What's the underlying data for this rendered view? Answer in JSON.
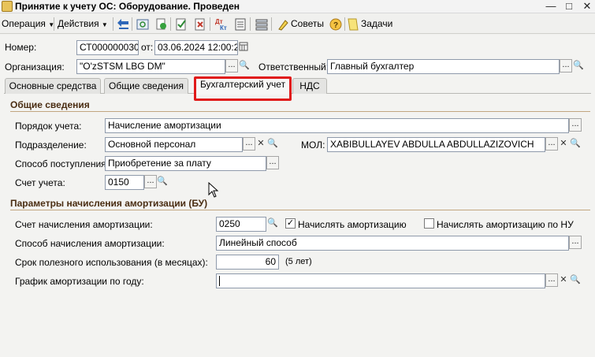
{
  "window": {
    "title": "Принятие к учету ОС: Оборудование. Проведен",
    "icon": "document-icon",
    "controls": [
      "minimize-icon",
      "maximize-icon",
      "close-icon"
    ]
  },
  "toolbar": {
    "operation_label": "Операция",
    "actions_label": "Действия",
    "tips_label": "Советы",
    "tasks_label": "Задачи"
  },
  "header": {
    "number_label": "Номер:",
    "number_value": "СТ000000030",
    "date_label": "от:",
    "date_value": "03.06.2024 12:00:28",
    "organization_label": "Организация:",
    "organization_value": "\"O'zSTSM LBG DM\"",
    "responsible_label": "Ответственный:",
    "responsible_value": "Главный бухгалтер"
  },
  "tabs": [
    {
      "label": "Основные средства",
      "active": false
    },
    {
      "label": "Общие сведения",
      "active": false
    },
    {
      "label": "Бухгалтерский учет",
      "active": true
    },
    {
      "label": "НДС",
      "active": false
    }
  ],
  "general": {
    "section_title": "Общие сведения",
    "order_label": "Порядок учета:",
    "order_value": "Начисление амортизации",
    "division_label": "Подразделение:",
    "division_value": "Основной персонал",
    "mol_label": "МОЛ:",
    "mol_value": "XABIBULLAYEV ABDULLA ABDULLAZIZOVICH",
    "receipt_label": "Способ поступления:",
    "receipt_value": "Приобретение за плату",
    "account_label": "Счет учета:",
    "account_value": "0150"
  },
  "amortization": {
    "section_title": "Параметры начисления амортизации (БУ)",
    "account_label": "Счет начисления амортизации:",
    "account_value": "0250",
    "charge_label": "Начислять амортизацию",
    "charge_checked": true,
    "charge_nu_label": "Начислять амортизацию по НУ",
    "charge_nu_checked": false,
    "method_label": "Способ начисления амортизации:",
    "method_value": "Линейный способ",
    "term_label": "Срок полезного использования (в месяцах):",
    "term_value": "60",
    "term_hint": "(5 лет)",
    "schedule_label": "График амортизации по году:",
    "schedule_value": ""
  },
  "colors": {
    "tab_highlight": "#e01919",
    "section_title": "#4a2d12",
    "field_border": "#8f9aab"
  }
}
